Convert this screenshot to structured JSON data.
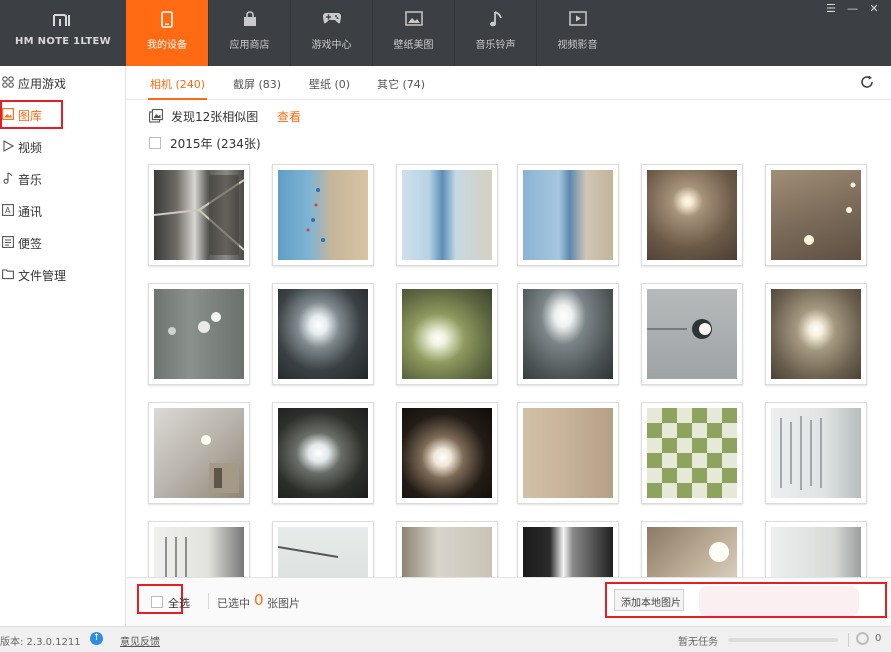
{
  "device": {
    "logo": "mi",
    "model": "HM NOTE 1LTEW"
  },
  "nav": [
    {
      "label": "我的设备",
      "icon": "phone-icon",
      "active": true
    },
    {
      "label": "应用商店",
      "icon": "bag-icon",
      "active": false
    },
    {
      "label": "游戏中心",
      "icon": "gamepad-icon",
      "active": false
    },
    {
      "label": "壁纸美图",
      "icon": "picture-icon",
      "active": false
    },
    {
      "label": "音乐铃声",
      "icon": "music-note-icon",
      "active": false
    },
    {
      "label": "视频影音",
      "icon": "video-icon",
      "active": false
    }
  ],
  "window_controls": {
    "menu": "☰",
    "minimize": "—",
    "close": "✕"
  },
  "sidebar": {
    "items": [
      {
        "label": "应用游戏",
        "icon": "apps-grid-icon"
      },
      {
        "label": "图库",
        "icon": "image-icon",
        "active": true
      },
      {
        "label": "视频",
        "icon": "play-icon"
      },
      {
        "label": "音乐",
        "icon": "music-note-icon"
      },
      {
        "label": "通讯",
        "icon": "contacts-icon"
      },
      {
        "label": "便签",
        "icon": "note-icon"
      },
      {
        "label": "文件管理",
        "icon": "folder-icon"
      }
    ]
  },
  "tabs": [
    {
      "label": "相机 (240)",
      "active": true
    },
    {
      "label": "截屏 (83)"
    },
    {
      "label": "壁纸 (0)"
    },
    {
      "label": "其它 (74)"
    }
  ],
  "similar": {
    "text": "发现12张相似图",
    "link": "查看"
  },
  "year_group": {
    "label": "2015年 (234张)"
  },
  "bottom": {
    "select_all": "全选",
    "selected_prefix": "已选中",
    "selected_count": "0",
    "selected_suffix": "张图片",
    "add_local": "添加本地图片"
  },
  "status": {
    "version": "版本: 2.3.0.1211",
    "feedback": "意见反馈",
    "tasks": "暂无任务",
    "task_count": "0"
  },
  "colors": {
    "accent": "#ff6a12",
    "topbar": "#3c4045",
    "highlight_box": "#e21e26"
  }
}
